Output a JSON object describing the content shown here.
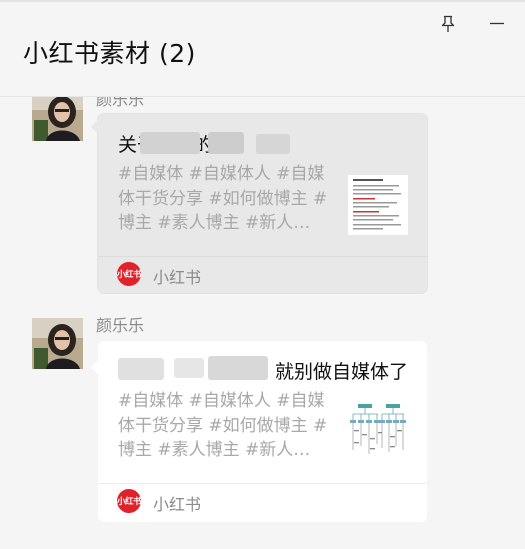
{
  "header": {
    "title": "小红书素材 (2)"
  },
  "messages": [
    {
      "sender": "颜乐乐",
      "card": {
        "title": "关于正确的…",
        "description": "#自媒体 #自媒体人 #自媒体干货分享 #如何做博主 #博主 #素人博主 #新人…",
        "source": "小红书",
        "source_logo": "小红书"
      }
    },
    {
      "sender": "颜乐乐",
      "card": {
        "title": "就别做自媒体了",
        "description": "#自媒体 #自媒体人 #自媒体干货分享 #如何做博主 #博主 #素人博主 #新人…",
        "source": "小红书",
        "source_logo": "小红书"
      }
    }
  ],
  "colors": {
    "brand": "#e1222c",
    "selected_card": "#e8e8e8",
    "card": "#ffffff"
  },
  "icons": {
    "pin": "pin-icon",
    "minimize": "minimize-icon"
  }
}
